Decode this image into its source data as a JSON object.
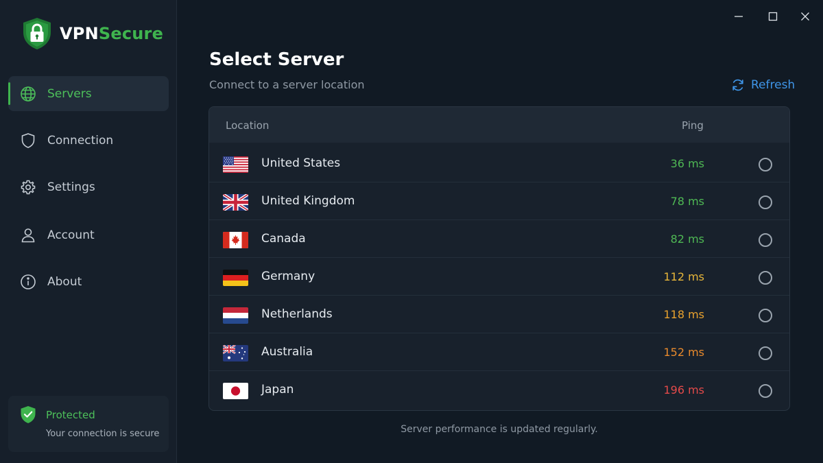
{
  "brand": {
    "part1": "VPN",
    "part2": "Secure"
  },
  "sidebar": {
    "items": [
      {
        "label": "Servers",
        "icon": "globe-icon",
        "active": true
      },
      {
        "label": "Connection",
        "icon": "shield-icon",
        "active": false
      },
      {
        "label": "Settings",
        "icon": "gear-icon",
        "active": false
      },
      {
        "label": "Account",
        "icon": "user-icon",
        "active": false
      },
      {
        "label": "About",
        "icon": "info-icon",
        "active": false
      }
    ],
    "status": {
      "title": "Protected",
      "subtitle": "Your connection is secure",
      "icon": "shield-check-icon"
    }
  },
  "window": {
    "controls": [
      "minimize-icon",
      "maximize-icon",
      "close-icon"
    ]
  },
  "main": {
    "title": "Select Server",
    "subtitle": "Connect to a server location",
    "refresh_label": "Refresh",
    "table": {
      "columns": [
        "Location",
        "Ping"
      ],
      "rows": [
        {
          "country": "United States",
          "ping": "36 ms",
          "flag": "us-flag-icon"
        },
        {
          "country": "United Kingdom",
          "ping": "78 ms",
          "flag": "uk-flag-icon"
        },
        {
          "country": "Canada",
          "ping": "82 ms",
          "flag": "canada-flag-icon"
        },
        {
          "country": "Germany",
          "ping": "112 ms",
          "flag": "germany-flag-icon"
        },
        {
          "country": "Netherlands",
          "ping": "118 ms",
          "flag": "netherlands-flag-icon"
        },
        {
          "country": "Australia",
          "ping": "152 ms",
          "flag": "australia-flag-icon"
        },
        {
          "country": "Japan",
          "ping": "196 ms",
          "flag": "japan-flag-icon"
        }
      ]
    },
    "footer_note": "Server performance is updated regularly."
  },
  "colors": {
    "accent_green": "#3fb44e",
    "accent_blue": "#3f95e8",
    "ping_good": "#4fb954",
    "ping_medium": "#e8b73a",
    "ping_orange": "#e98a2c",
    "ping_bad": "#e44a4a"
  }
}
